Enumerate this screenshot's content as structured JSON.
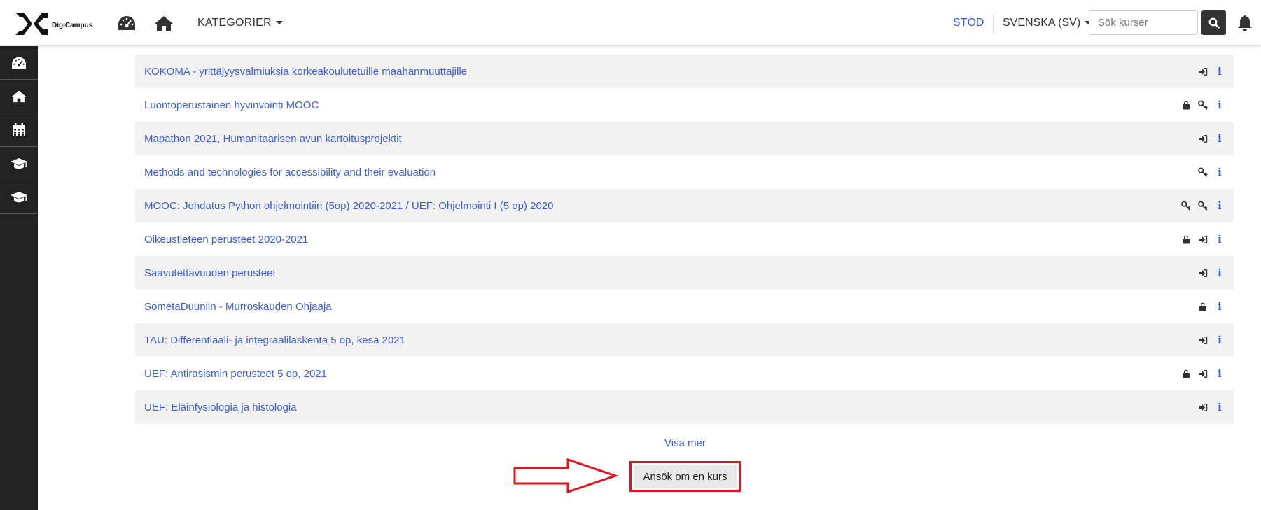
{
  "navbar": {
    "brand_name": "DigiCampus",
    "kategorier_label": "KATEGORIER",
    "support_label": "STÖD",
    "language_label": "SVENSKA (SV)",
    "search_placeholder": "Sök kurser",
    "icons": [
      "dashboard-icon",
      "home-icon",
      "search-icon",
      "bell-icon"
    ]
  },
  "sidebar": {
    "items": [
      {
        "name": "dashboard",
        "icon": "dashboard-icon"
      },
      {
        "name": "home",
        "icon": "home-icon"
      },
      {
        "name": "calendar",
        "icon": "calendar-icon"
      },
      {
        "name": "course-1",
        "icon": "graduation-cap-icon"
      },
      {
        "name": "course-2",
        "icon": "graduation-cap-icon"
      }
    ]
  },
  "courses": [
    {
      "title": "KOKOMA - yrittäjyysvalmiuksia korkeakoulutetuille maahanmuuttajille",
      "icons": [
        "enrol",
        "info"
      ]
    },
    {
      "title": "Luontoperustainen hyvinvointi MOOC",
      "icons": [
        "unlock",
        "key",
        "info"
      ]
    },
    {
      "title": "Mapathon 2021, Humanitaarisen avun kartoitusprojektit",
      "icons": [
        "enrol",
        "info"
      ]
    },
    {
      "title": "Methods and technologies for accessibility and their evaluation",
      "icons": [
        "key",
        "info"
      ]
    },
    {
      "title": "MOOC: Johdatus Python ohjelmointiin (5op) 2020-2021 / UEF: Ohjelmointi I (5 op) 2020",
      "icons": [
        "key",
        "key",
        "info"
      ]
    },
    {
      "title": "Oikeustieteen perusteet 2020-2021",
      "icons": [
        "unlock",
        "enrol",
        "info"
      ]
    },
    {
      "title": "Saavutettavuuden perusteet",
      "icons": [
        "enrol",
        "info"
      ]
    },
    {
      "title": "SometaDuuniin - Murroskauden Ohjaaja",
      "icons": [
        "unlock",
        "info"
      ]
    },
    {
      "title": "TAU: Differentiaali- ja integraalilaskenta 5 op, kesä 2021",
      "icons": [
        "enrol",
        "info"
      ]
    },
    {
      "title": "UEF: Antirasismin perusteet 5 op, 2021",
      "icons": [
        "unlock",
        "enrol",
        "info"
      ]
    },
    {
      "title": "UEF: Eläinfysiologia ja histologia",
      "icons": [
        "enrol",
        "info"
      ]
    }
  ],
  "visa_mer_label": "Visa mer",
  "apply_button_label": "Ansök om en kurs",
  "info_glyph": "i",
  "colors": {
    "link": "#3b5ed6",
    "highlight": "#e3141d",
    "sidebar": "#222222"
  }
}
